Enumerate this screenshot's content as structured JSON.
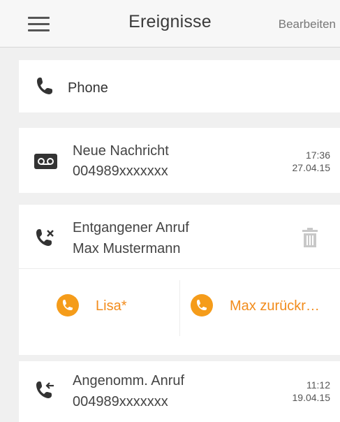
{
  "header": {
    "title": "Ereignisse",
    "edit_label": "Bearbeiten"
  },
  "phone_card": {
    "label": "Phone",
    "icon": "phone-icon"
  },
  "events": [
    {
      "type": "voicemail",
      "icon": "voicemail-icon",
      "title": "Neue Nachricht",
      "number": "004989xxxxxxx",
      "time": "17:36",
      "date": "27.04.15"
    },
    {
      "type": "missed",
      "icon": "missed-call-icon",
      "title": "Entgangener Anruf",
      "caller": "Max Mustermann",
      "actions": [
        {
          "label": "Lisa*",
          "icon": "phone-icon"
        },
        {
          "label": "Max zurückr…",
          "icon": "phone-icon"
        }
      ]
    },
    {
      "type": "accepted",
      "icon": "incoming-call-icon",
      "title": "Angenomm. Anruf",
      "number": "004989xxxxxxx",
      "time": "11:12",
      "date": "19.04.15"
    }
  ],
  "colors": {
    "accent": "#f59c1a",
    "accent_text": "#f28c1c",
    "background": "#f0f0f0",
    "card": "#ffffff"
  }
}
